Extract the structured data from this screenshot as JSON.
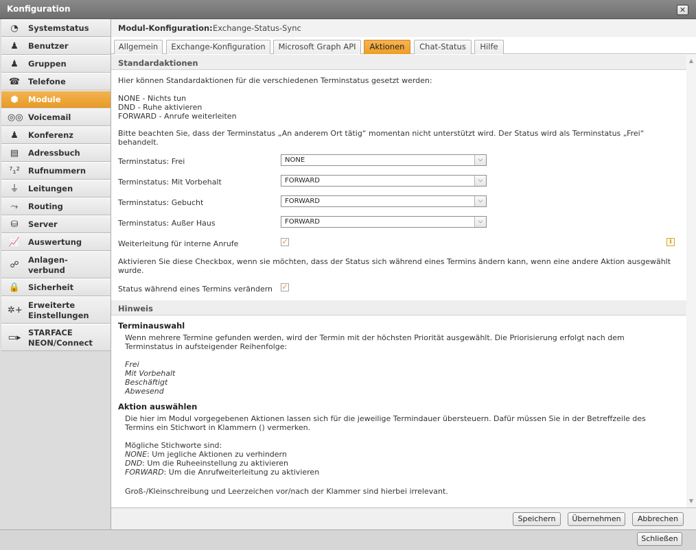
{
  "window": {
    "title": "Konfiguration",
    "close_glyph": "✕"
  },
  "sidebar": {
    "items": [
      {
        "label": "Systemstatus",
        "icon": "gauge-icon",
        "glyph": "◔"
      },
      {
        "label": "Benutzer",
        "icon": "user-icon",
        "glyph": "♟"
      },
      {
        "label": "Gruppen",
        "icon": "group-icon",
        "glyph": "♟"
      },
      {
        "label": "Telefone",
        "icon": "phone-icon",
        "glyph": "☎"
      },
      {
        "label": "Module",
        "icon": "cube-icon",
        "glyph": "⬢"
      },
      {
        "label": "Voicemail",
        "icon": "voicemail-icon",
        "glyph": "◎◎"
      },
      {
        "label": "Konferenz",
        "icon": "conference-icon",
        "glyph": "♟"
      },
      {
        "label": "Adressbuch",
        "icon": "addressbook-icon",
        "glyph": "▤"
      },
      {
        "label": "Rufnummern",
        "icon": "numbers-icon",
        "glyph": "⁷₁²"
      },
      {
        "label": "Leitungen",
        "icon": "lines-icon",
        "glyph": "⏚"
      },
      {
        "label": "Routing",
        "icon": "routing-icon",
        "glyph": "⤳"
      },
      {
        "label": "Server",
        "icon": "server-icon",
        "glyph": "⛁"
      },
      {
        "label": "Auswertung",
        "icon": "chart-icon",
        "glyph": "📈"
      },
      {
        "label": "Anlagen-",
        "label2": "verbund",
        "icon": "network-icon",
        "glyph": "☍"
      },
      {
        "label": "Sicherheit",
        "icon": "lock-icon",
        "glyph": "🔒"
      },
      {
        "label": "Erweiterte",
        "label2": "Einstellungen",
        "icon": "advanced-settings-icon",
        "glyph": "✲+"
      },
      {
        "label": "STARFACE",
        "label2": "NEON/Connect",
        "icon": "video-icon",
        "glyph": "▭▸"
      }
    ],
    "active_index": 4
  },
  "module": {
    "heading_label": "Modul-Konfiguration:",
    "heading_value": "Exchange-Status-Sync"
  },
  "tabs": [
    {
      "label": "Allgemein"
    },
    {
      "label": "Exchange-Konfiguration"
    },
    {
      "label": "Microsoft Graph API"
    },
    {
      "label": "Aktionen"
    },
    {
      "label": "Chat-Status"
    },
    {
      "label": "Hilfe"
    }
  ],
  "active_tab": 3,
  "standard": {
    "title": "Standardaktionen",
    "intro": "Hier können Standardaktionen für die verschiedenen Terminstatus gesetzt werden:",
    "options": [
      "NONE - Nichts tun",
      "DND - Ruhe aktivieren",
      "FORWARD - Anrufe weiterleiten"
    ],
    "note_line1": "Bitte beachten Sie, dass der Terminstatus „An anderem Ort tätig“ momentan nicht unterstützt wird. Der Status wird als Terminstatus „Frei“",
    "note_line2": "behandelt.",
    "fields": [
      {
        "label": "Terminstatus: Frei",
        "value": "NONE"
      },
      {
        "label": "Terminstatus: Mit Vorbehalt",
        "value": "FORWARD"
      },
      {
        "label": "Terminstatus: Gebucht",
        "value": "FORWARD"
      },
      {
        "label": "Terminstatus: Außer Haus",
        "value": "FORWARD"
      }
    ],
    "internal_forward_label": "Weiterleitung für interne Anrufe",
    "internal_forward_checked": true,
    "change_desc_line1": "Aktivieren Sie diese Checkbox, wenn sie möchten, dass der Status sich während eines Termins ändern kann, wenn eine andere Aktion ausgewählt",
    "change_desc_line2": "wurde.",
    "change_status_label": "Status während eines Termins verändern",
    "change_status_checked": true,
    "info_glyph": "i",
    "check_glyph": "✓",
    "select_arrow": "⌵"
  },
  "hint": {
    "title": "Hinweis",
    "terminauswahl_title": "Terminauswahl",
    "terminauswahl_line1": "Wenn mehrere Termine gefunden werden, wird der Termin mit der höchsten Priorität ausgewählt. Die Priorisierung erfolgt nach dem",
    "terminauswahl_line2": "Terminstatus in aufsteigender Reihenfolge:",
    "priorities": [
      "Frei",
      "Mit Vorbehalt",
      "Beschäftigt",
      "Abwesend"
    ],
    "aktion_title": "Aktion auswählen",
    "aktion_line1": "Die hier im Modul vorgegebenen Aktionen lassen sich für die jeweilige Termindauer übersteuern. Dafür müssen Sie in der Betreffzeile des",
    "aktion_line2": "Termins ein Stichwort in Klammern () vermerken.",
    "keywords_intro": "Mögliche Stichworte sind:",
    "keywords": [
      {
        "key": "NONE",
        "desc": ": Um jegliche Aktionen zu verhindern"
      },
      {
        "key": "DND",
        "desc": ": Um die Ruheeinstellung zu aktivieren"
      },
      {
        "key": "FORWARD",
        "desc": ": Um die Anrufweiterleitung zu aktivieren"
      }
    ],
    "case_note": "Groß-/Kleinschreibung und Leerzeichen vor/nach der Klammer sind hierbei irrelevant."
  },
  "buttons": {
    "save": "Speichern",
    "apply": "Übernehmen",
    "cancel": "Abbrechen",
    "close": "Schließen"
  },
  "scroll": {
    "up": "▲",
    "down": "▼"
  }
}
